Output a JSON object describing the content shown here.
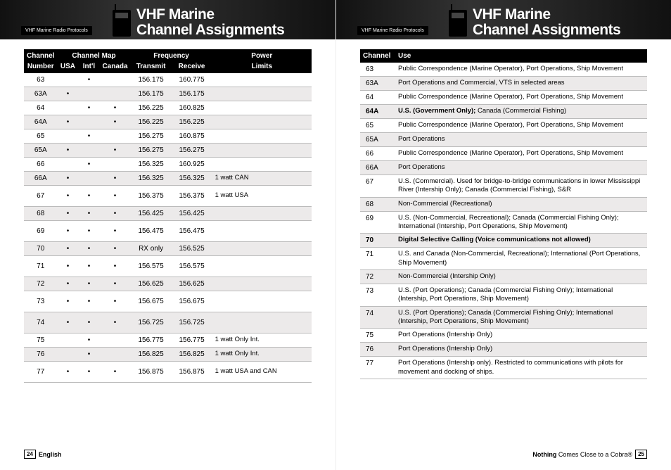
{
  "header": {
    "tab": "VHF Marine Radio Protocols",
    "title_line1": "VHF Marine",
    "title_line2": "Channel Assignments"
  },
  "left_table": {
    "top_headers": {
      "channel": "Channel",
      "map": "Channel Map",
      "freq": "Frequency",
      "power": "Power"
    },
    "sub_headers": {
      "number": "Number",
      "usa": "USA",
      "intl": "Int'l",
      "canada": "Canada",
      "tx": "Transmit",
      "rx": "Receive",
      "limits": "Limits"
    },
    "rows": [
      {
        "ch": "63",
        "usa": "",
        "intl": "•",
        "can": "",
        "tx": "156.175",
        "rx": "160.775",
        "pw": "",
        "tall": false,
        "alt": false
      },
      {
        "ch": "63A",
        "usa": "•",
        "intl": "",
        "can": "",
        "tx": "156.175",
        "rx": "156.175",
        "pw": "",
        "tall": false,
        "alt": true
      },
      {
        "ch": "64",
        "usa": "",
        "intl": "•",
        "can": "•",
        "tx": "156.225",
        "rx": "160.825",
        "pw": "",
        "tall": false,
        "alt": false
      },
      {
        "ch": "64A",
        "usa": "•",
        "intl": "",
        "can": "•",
        "tx": "156.225",
        "rx": "156.225",
        "pw": "",
        "tall": false,
        "alt": true
      },
      {
        "ch": "65",
        "usa": "",
        "intl": "•",
        "can": "",
        "tx": "156.275",
        "rx": "160.875",
        "pw": "",
        "tall": false,
        "alt": false
      },
      {
        "ch": "65A",
        "usa": "•",
        "intl": "",
        "can": "•",
        "tx": "156.275",
        "rx": "156.275",
        "pw": "",
        "tall": false,
        "alt": true
      },
      {
        "ch": "66",
        "usa": "",
        "intl": "•",
        "can": "",
        "tx": "156.325",
        "rx": "160.925",
        "pw": "",
        "tall": false,
        "alt": false
      },
      {
        "ch": "66A",
        "usa": "•",
        "intl": "",
        "can": "•",
        "tx": "156.325",
        "rx": "156.325",
        "pw": "1 watt CAN",
        "tall": false,
        "alt": true
      },
      {
        "ch": "67",
        "usa": "•",
        "intl": "•",
        "can": "•",
        "tx": "156.375",
        "rx": "156.375",
        "pw": "1 watt USA",
        "tall": true,
        "alt": false
      },
      {
        "ch": "68",
        "usa": "•",
        "intl": "•",
        "can": "•",
        "tx": "156.425",
        "rx": "156.425",
        "pw": "",
        "tall": false,
        "alt": true
      },
      {
        "ch": "69",
        "usa": "•",
        "intl": "•",
        "can": "•",
        "tx": "156.475",
        "rx": "156.475",
        "pw": "",
        "tall": true,
        "alt": false
      },
      {
        "ch": "70",
        "usa": "•",
        "intl": "•",
        "can": "•",
        "tx": "RX only",
        "rx": "156.525",
        "pw": "",
        "tall": false,
        "alt": true
      },
      {
        "ch": "71",
        "usa": "•",
        "intl": "•",
        "can": "•",
        "tx": "156.575",
        "rx": "156.575",
        "pw": "",
        "tall": true,
        "alt": false
      },
      {
        "ch": "72",
        "usa": "•",
        "intl": "•",
        "can": "•",
        "tx": "156.625",
        "rx": "156.625",
        "pw": "",
        "tall": false,
        "alt": true
      },
      {
        "ch": "73",
        "usa": "•",
        "intl": "•",
        "can": "•",
        "tx": "156.675",
        "rx": "156.675",
        "pw": "",
        "tall": true,
        "alt": false
      },
      {
        "ch": "74",
        "usa": "•",
        "intl": "•",
        "can": "•",
        "tx": "156.725",
        "rx": "156.725",
        "pw": "",
        "tall": true,
        "alt": true
      },
      {
        "ch": "75",
        "usa": "",
        "intl": "•",
        "can": "",
        "tx": "156.775",
        "rx": "156.775",
        "pw": "1 watt Only Int.",
        "tall": false,
        "alt": false
      },
      {
        "ch": "76",
        "usa": "",
        "intl": "•",
        "can": "",
        "tx": "156.825",
        "rx": "156.825",
        "pw": "1 watt Only Int.",
        "tall": false,
        "alt": true
      },
      {
        "ch": "77",
        "usa": "•",
        "intl": "•",
        "can": "•",
        "tx": "156.875",
        "rx": "156.875",
        "pw": "1 watt USA and CAN",
        "tall": true,
        "alt": false
      }
    ]
  },
  "right_table": {
    "headers": {
      "channel": "Channel",
      "use": "Use"
    },
    "rows": [
      {
        "ch": "63",
        "use": "Public Correspondence (Marine Operator), Port Operations, Ship Movement",
        "bold": false,
        "alt": false
      },
      {
        "ch": "63A",
        "use": "Port Operations and Commercial, VTS in selected areas",
        "bold": false,
        "alt": true
      },
      {
        "ch": "64",
        "use": "Public Correspondence (Marine Operator), Port Operations, Ship Movement",
        "bold": false,
        "alt": false
      },
      {
        "ch": "64A",
        "use": "U.S. (Government Only); Canada (Commercial Fishing)",
        "ch_bold": true,
        "use_bold_prefix": "U.S. (Government Only);",
        "use_rest": " Canada (Commercial Fishing)",
        "alt": true,
        "mixed": true
      },
      {
        "ch": "65",
        "use": "Public Correspondence (Marine Operator), Port Operations, Ship Movement",
        "bold": false,
        "alt": false
      },
      {
        "ch": "65A",
        "use": "Port Operations",
        "bold": false,
        "alt": true
      },
      {
        "ch": "66",
        "use": "Public Correspondence (Marine Operator), Port Operations, Ship Movement",
        "bold": false,
        "alt": false
      },
      {
        "ch": "66A",
        "use": "Port Operations",
        "bold": false,
        "alt": true
      },
      {
        "ch": "67",
        "use": "U.S. (Commercial). Used for bridge-to-bridge communications in lower Mississippi River (Intership Only); Canada (Commercial Fishing), S&R",
        "bold": false,
        "alt": false
      },
      {
        "ch": "68",
        "use": "Non-Commercial (Recreational)",
        "bold": false,
        "alt": true
      },
      {
        "ch": "69",
        "use": "U.S. (Non-Commercial, Recreational); Canada (Commercial Fishing Only); International (Intership, Port Operations, Ship Movement)",
        "bold": false,
        "alt": false
      },
      {
        "ch": "70",
        "use": "Digital Selective Calling (Voice communications not allowed)",
        "bold": true,
        "alt": true
      },
      {
        "ch": "71",
        "use": "U.S. and Canada (Non-Commercial, Recreational); International (Port Operations, Ship Movement)",
        "bold": false,
        "alt": false
      },
      {
        "ch": "72",
        "use": "Non-Commercial (Intership Only)",
        "bold": false,
        "alt": true
      },
      {
        "ch": "73",
        "use": "U.S. (Port Operations); Canada (Commercial Fishing Only); International (Intership, Port Operations, Ship Movement)",
        "bold": false,
        "alt": false
      },
      {
        "ch": "74",
        "use": "U.S. (Port Operations); Canada (Commercial Fishing Only); International (Intership, Port Operations, Ship Movement)",
        "bold": false,
        "alt": true
      },
      {
        "ch": "75",
        "use": "Port Operations (Intership Only)",
        "bold": false,
        "alt": false
      },
      {
        "ch": "76",
        "use": "Port Operations (Intership Only)",
        "bold": false,
        "alt": true
      },
      {
        "ch": "77",
        "use": "Port Operations (Intership only). Restricted to communications with pilots for movement and docking of ships.",
        "bold": false,
        "alt": false
      }
    ]
  },
  "footer": {
    "left_page_num": "24",
    "left_lang": "English",
    "right_slogan_bold": "Nothing",
    "right_slogan_rest": " Comes Close to a Cobra®",
    "right_page_num": "25"
  }
}
